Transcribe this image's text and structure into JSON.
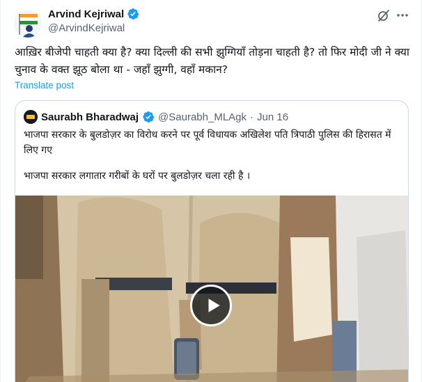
{
  "post": {
    "author_name": "Arvind Kejriwal",
    "author_handle": "@ArvindKejriwal",
    "text": "आख़िर बीजेपी चाहती क्या है? क्या दिल्ली की सभी झुग्गियाँ तोड़ना चाहती है? तो फिर मोदी जी ने क्या चुनाव के वक्त झूठ बोला था - जहाँ झुग्गी, वहाँ मकान?",
    "translate_label": "Translate post"
  },
  "quoted_post": {
    "author_name": "Saurabh Bharadwaj",
    "author_handle": "@Saurabh_MLAgk",
    "separator": "·",
    "date": "Jun 16",
    "text_line1": "भाजपा सरकार के बुलडोज़र का विरोध करने पर पूर्व विधायक अखिलेश पति त्रिपाठी पुलिस की हिरासत में लिए गए",
    "text_line2": "भाजपा सरकार लगातार गरीबों के घरों पर बुलडोज़र चला रही है ।"
  },
  "icons": {
    "verified": "verified-badge-icon",
    "grok": "grok-icon",
    "more": "more-options-icon",
    "play": "play-icon"
  },
  "colors": {
    "accent": "#1d9bf0",
    "text_primary": "#0f1419",
    "text_secondary": "#536471",
    "border": "#cfd9de"
  }
}
